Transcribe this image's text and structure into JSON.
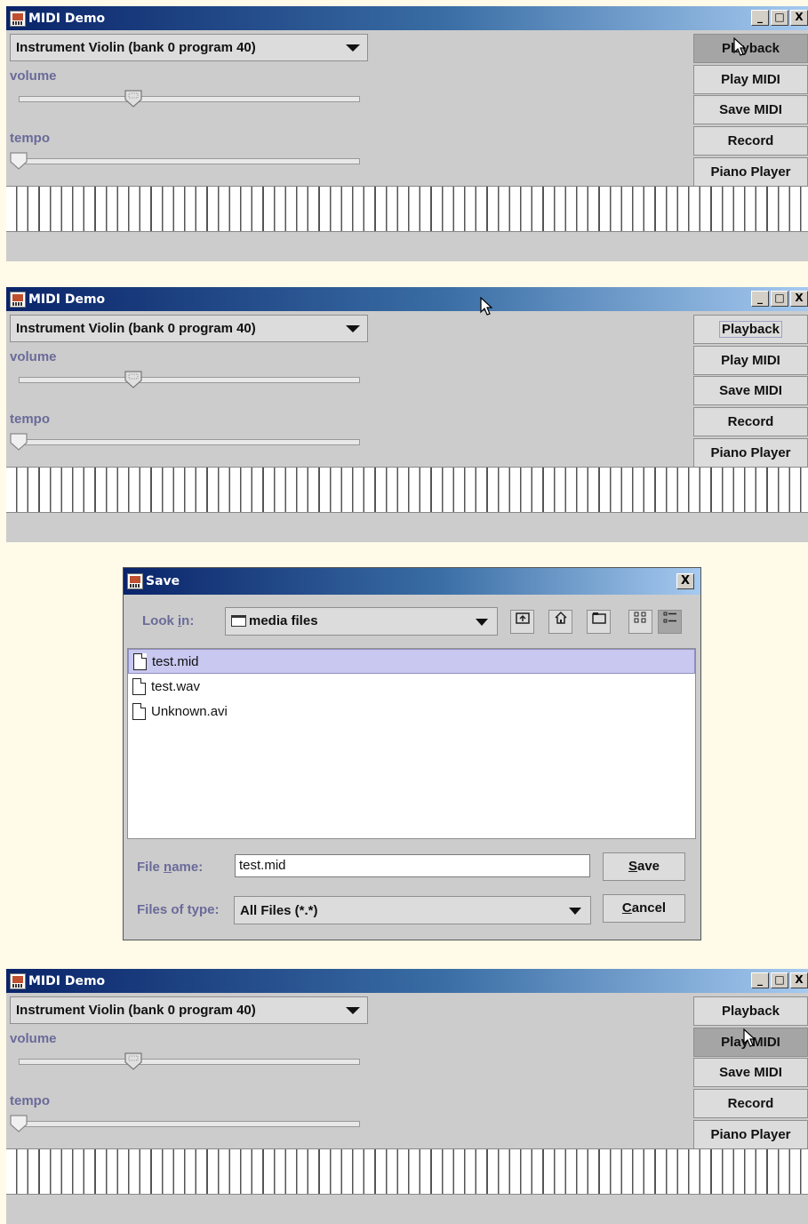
{
  "windows": [
    {
      "title": "MIDI Demo",
      "instrument": "Instrument Violin (bank 0 program 40)",
      "volume_label": "volume",
      "tempo_label": "tempo",
      "volume_level": 0.34,
      "tempo_level": 0.0,
      "buttons": [
        {
          "label": "Playback",
          "state": "pressed"
        },
        {
          "label": "Play MIDI",
          "state": "normal"
        },
        {
          "label": "Save MIDI",
          "state": "normal"
        },
        {
          "label": "Record",
          "state": "normal"
        },
        {
          "label": "Piano Player",
          "state": "normal"
        }
      ],
      "window_controls": {
        "minimize": "_",
        "maximize": "□",
        "close": "X"
      }
    },
    {
      "title": "MIDI Demo",
      "instrument": "Instrument Violin (bank 0 program 40)",
      "volume_label": "volume",
      "tempo_label": "tempo",
      "volume_level": 0.34,
      "tempo_level": 0.0,
      "buttons": [
        {
          "label": "Playback",
          "state": "focused"
        },
        {
          "label": "Play MIDI",
          "state": "normal"
        },
        {
          "label": "Save MIDI",
          "state": "normal"
        },
        {
          "label": "Record",
          "state": "normal"
        },
        {
          "label": "Piano Player",
          "state": "normal"
        }
      ],
      "window_controls": {
        "minimize": "_",
        "maximize": "□",
        "close": "X"
      }
    },
    {
      "title": "MIDI Demo",
      "instrument": "Instrument Violin (bank 0 program 40)",
      "volume_label": "volume",
      "tempo_label": "tempo",
      "volume_level": 0.34,
      "tempo_level": 0.0,
      "buttons": [
        {
          "label": "Playback",
          "state": "normal"
        },
        {
          "label": "Play MIDI",
          "state": "pressed"
        },
        {
          "label": "Save MIDI",
          "state": "normal"
        },
        {
          "label": "Record",
          "state": "normal"
        },
        {
          "label": "Piano Player",
          "state": "normal"
        }
      ],
      "window_controls": {
        "minimize": "_",
        "maximize": "□",
        "close": "X"
      }
    }
  ],
  "save_dialog": {
    "title": "Save",
    "close": "X",
    "look_in_label_pre": "Look ",
    "look_in_label_u": "i",
    "look_in_label_post": "n:",
    "look_in_value": "media files",
    "toolbar_icons": [
      "up-folder-icon",
      "home-icon",
      "new-folder-icon",
      "list-view-icon",
      "details-view-icon"
    ],
    "files": [
      "test.mid",
      "test.wav",
      "Unknown.avi"
    ],
    "selected_file_index": 0,
    "file_name_label_pre": "File ",
    "file_name_label_u": "n",
    "file_name_label_post": "ame:",
    "file_name_value": "test.mid",
    "files_of_type_label": "Files of type:",
    "files_of_type_value": "All Files (*.*)",
    "save_u": "S",
    "save_rest": "ave",
    "cancel_u": "C",
    "cancel_rest": "ancel"
  },
  "colors": {
    "titlebar_start": "#0a246a",
    "titlebar_end": "#a6caf0",
    "label": "#6a6a9a",
    "panel": "#cccccc",
    "page": "#fffbe8"
  }
}
